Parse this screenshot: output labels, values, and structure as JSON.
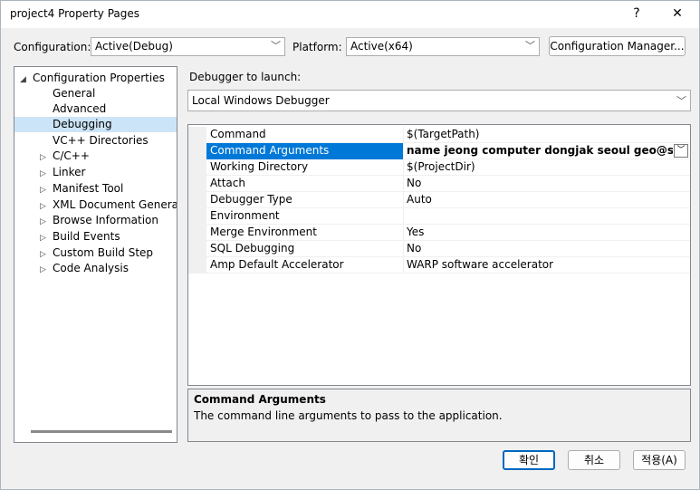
{
  "window": {
    "title": "project4 Property Pages",
    "help": "?",
    "close": "✕"
  },
  "configuration": {
    "label": "Configuration:",
    "value": "Active(Debug)"
  },
  "platform": {
    "label": "Platform:",
    "value": "Active(x64)"
  },
  "config_manager_label": "Configuration Manager...",
  "tree": {
    "items": [
      {
        "label": "Configuration Properties",
        "toggle": "◢"
      },
      {
        "label": "General"
      },
      {
        "label": "Advanced"
      },
      {
        "label": "Debugging",
        "selected": true
      },
      {
        "label": "VC++ Directories"
      },
      {
        "label": "C/C++",
        "toggle": "▷"
      },
      {
        "label": "Linker",
        "toggle": "▷"
      },
      {
        "label": "Manifest Tool",
        "toggle": "▷"
      },
      {
        "label": "XML Document Generator",
        "toggle": "▷"
      },
      {
        "label": "Browse Information",
        "toggle": "▷"
      },
      {
        "label": "Build Events",
        "toggle": "▷"
      },
      {
        "label": "Custom Build Step",
        "toggle": "▷"
      },
      {
        "label": "Code Analysis",
        "toggle": "▷"
      }
    ]
  },
  "debugger": {
    "label": "Debugger to launch:",
    "value": "Local Windows Debugger"
  },
  "properties": [
    {
      "name": "Command",
      "value": "$(TargetPath)"
    },
    {
      "name": "Command Arguments",
      "value": "name jeong computer dongjak seoul geo@ssu.ac.kr"
    },
    {
      "name": "Working Directory",
      "value": "$(ProjectDir)"
    },
    {
      "name": "Attach",
      "value": "No"
    },
    {
      "name": "Debugger Type",
      "value": "Auto"
    },
    {
      "name": "Environment",
      "value": ""
    },
    {
      "name": "Merge Environment",
      "value": "Yes"
    },
    {
      "name": "SQL Debugging",
      "value": "No"
    },
    {
      "name": "Amp Default Accelerator",
      "value": "WARP software accelerator"
    }
  ],
  "description": {
    "title": "Command Arguments",
    "text": "The command line arguments to pass to the application."
  },
  "buttons": {
    "ok": "확인",
    "cancel": "취소",
    "apply": "적용(A)"
  },
  "icons": {
    "chevron": "chevron-down-icon",
    "expanded": "expanded-triangle-icon",
    "collapsed": "collapsed-triangle-icon"
  },
  "colors": {
    "selection": "#0078d7",
    "tree_selection": "#cce4f7",
    "default_button_border": "#0067c0"
  }
}
